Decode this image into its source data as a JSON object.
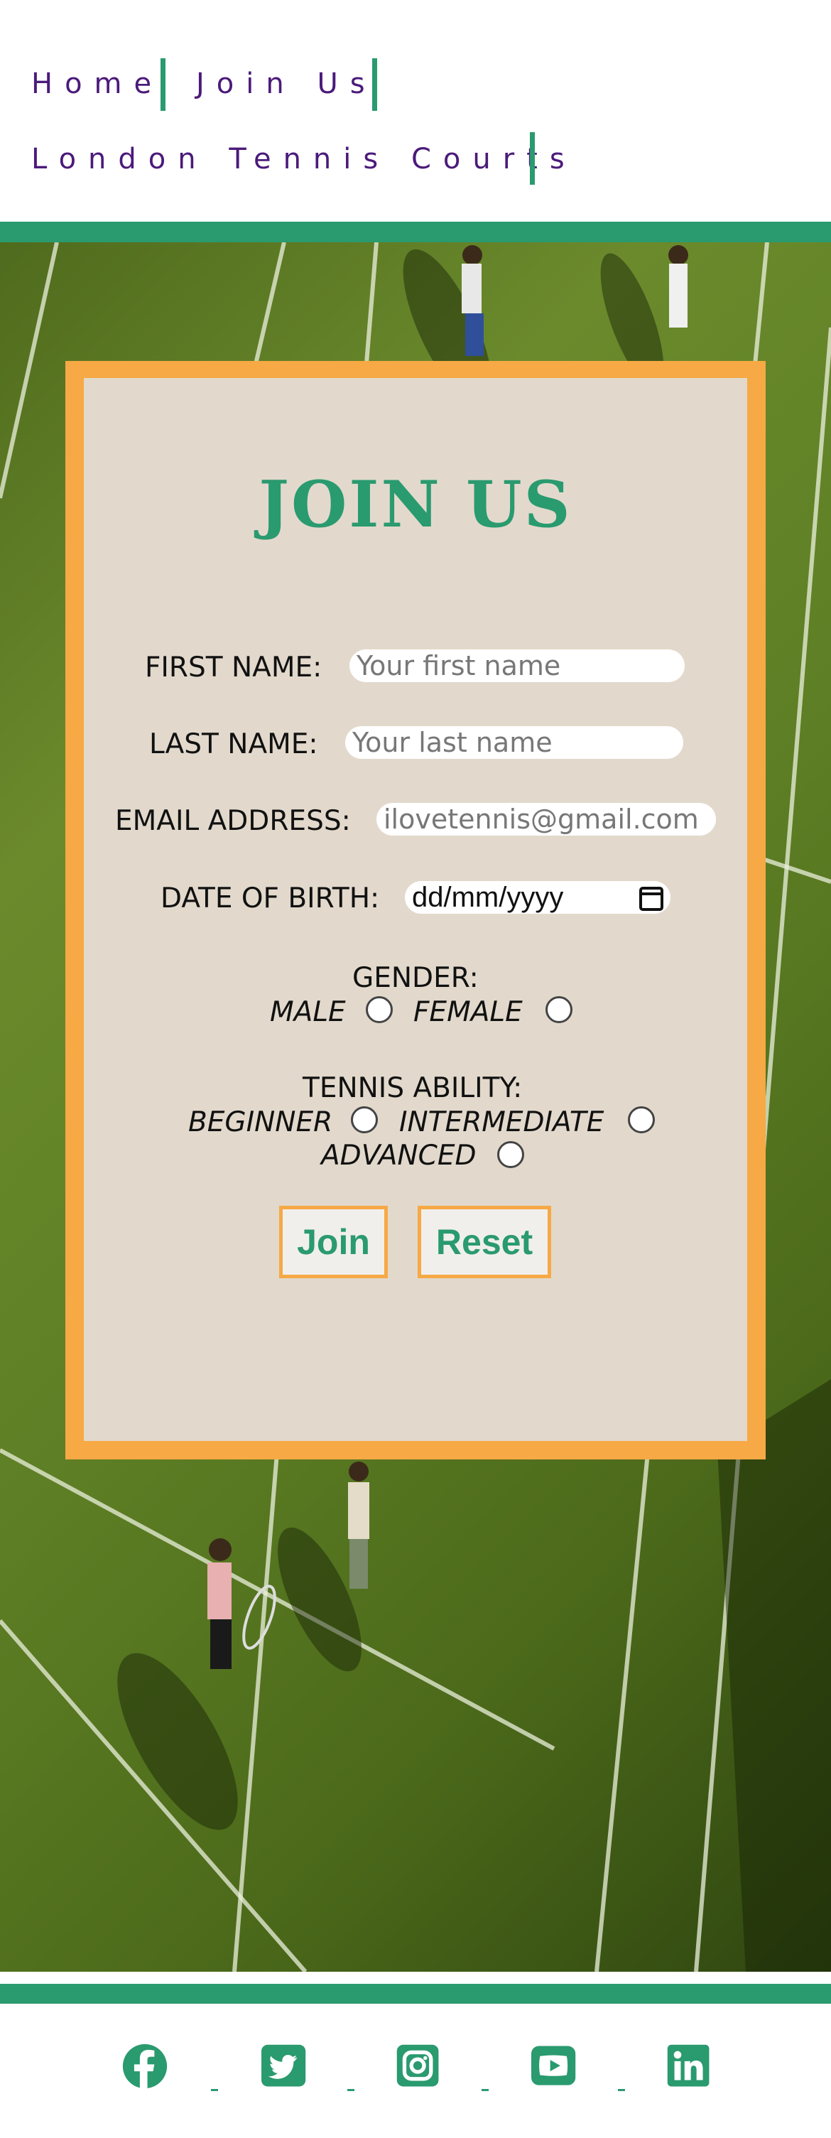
{
  "nav": {
    "home": "Home",
    "join_us": "Join Us",
    "courts": "London Tennis Courts"
  },
  "form": {
    "title": "JOIN US",
    "first_name_label": "FIRST NAME:",
    "first_name_placeholder": "Your first name",
    "last_name_label": "LAST NAME:",
    "last_name_placeholder": "Your last name",
    "email_label": "EMAIL ADDRESS:",
    "email_placeholder": "ilovetennis@gmail.com",
    "dob_label": "DATE OF BIRTH:",
    "dob_placeholder": "dd/mm/yyyy",
    "gender_label": "GENDER:",
    "gender_options": [
      "MALE",
      "FEMALE"
    ],
    "ability_label": "TENNIS ABILITY:",
    "ability_options": [
      "BEGINNER",
      "INTERMEDIATE",
      "ADVANCED"
    ],
    "join_button": "Join",
    "reset_button": "Reset"
  },
  "footer": {
    "icons": [
      "facebook-icon",
      "twitter-icon",
      "instagram-icon",
      "youtube-icon",
      "linkedin-icon"
    ]
  },
  "colors": {
    "accent_green": "#2a9a6f",
    "nav_purple": "#4b1a7a",
    "frame_orange": "#f6a945"
  }
}
